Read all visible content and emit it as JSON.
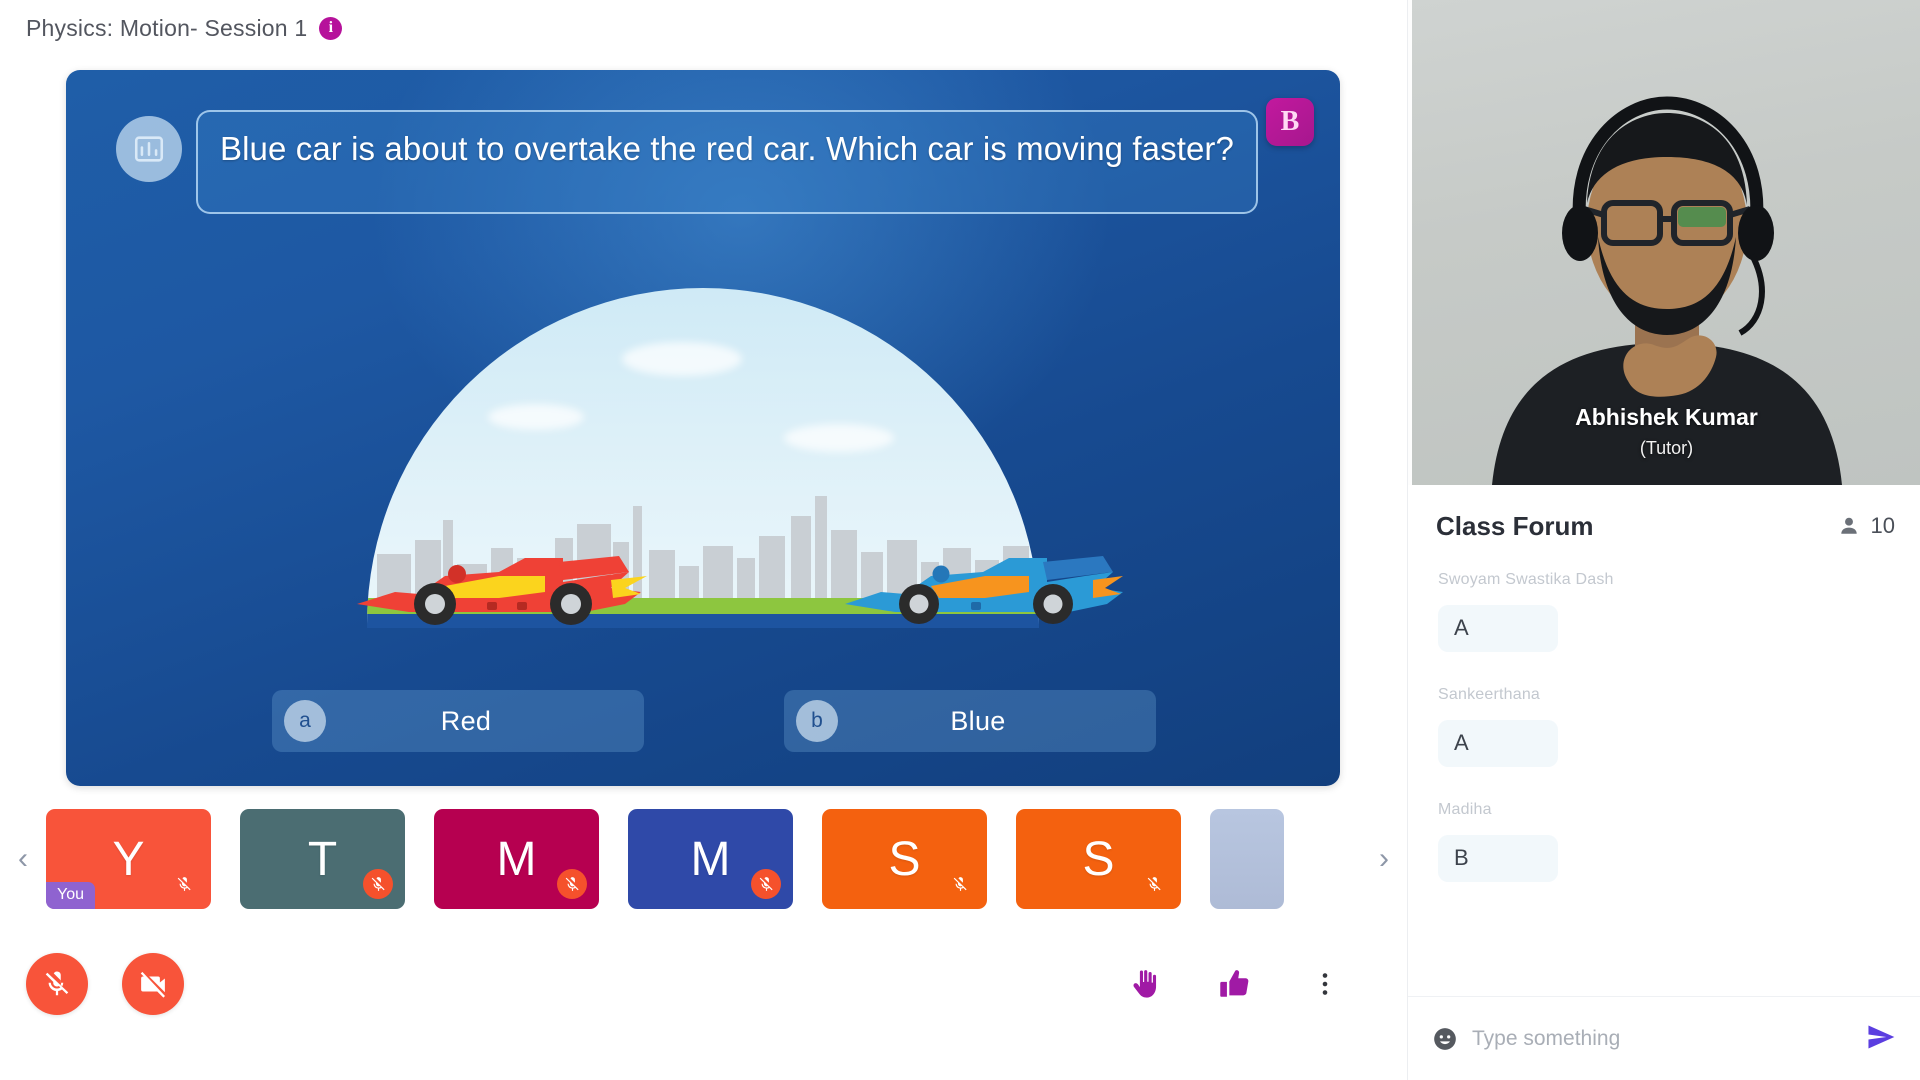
{
  "header": {
    "session_title": "Physics: Motion- Session 1",
    "info_icon": "info-icon",
    "info_glyph": "i"
  },
  "slide": {
    "poll_icon": "poll-chart-icon",
    "question": "Blue car is about to overtake the red car. Which car is moving faster?",
    "brand_badge": "B",
    "options": [
      {
        "key": "a",
        "label": "Red"
      },
      {
        "key": "b",
        "label": "Blue"
      }
    ],
    "illustration": {
      "name": "two-race-cars-city-skyline",
      "red_car": "red-race-car",
      "blue_car": "blue-race-car"
    }
  },
  "participants": {
    "prev_label": "‹",
    "next_label": "›",
    "you_badge": "You",
    "tiles": [
      {
        "letter": "Y",
        "color": "#f8543a",
        "muted": true,
        "is_you": true
      },
      {
        "letter": "T",
        "color": "#4b6d72",
        "muted": true,
        "is_you": false
      },
      {
        "letter": "M",
        "color": "#b60050",
        "muted": true,
        "is_you": false
      },
      {
        "letter": "M",
        "color": "#2f49a8",
        "muted": true,
        "is_you": false
      },
      {
        "letter": "S",
        "color": "#f4610f",
        "muted": true,
        "is_you": false
      },
      {
        "letter": "S",
        "color": "#f4610f",
        "muted": true,
        "is_you": false
      }
    ]
  },
  "controls": {
    "mic_button": "microphone-off",
    "camera_button": "camera-off",
    "raise_hand": "raise-hand",
    "thumbs_up": "thumbs-up",
    "more": "more-options"
  },
  "video": {
    "name": "Abhishek Kumar",
    "role": "(Tutor)"
  },
  "forum": {
    "title": "Class Forum",
    "participant_count": "10",
    "people_icon": "people-icon",
    "messages": [
      {
        "author": "Swoyam Swastika Dash",
        "text": "A"
      },
      {
        "author": "Sankeerthana",
        "text": "A"
      },
      {
        "author": "Madiha",
        "text": "B"
      }
    ],
    "composer": {
      "placeholder": "Type something",
      "value": "",
      "emoji_icon": "emoji-icon",
      "send_icon": "send-icon"
    }
  },
  "colors": {
    "accent_purple": "#6c4ee0",
    "brand_magenta": "#b6129b",
    "danger_red": "#f8543a",
    "slide_blue": "#1e58a3"
  }
}
